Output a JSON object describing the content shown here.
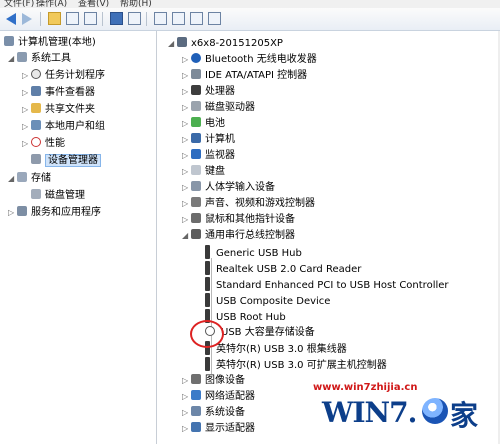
{
  "menu": {
    "file": "文件(F)",
    "action": "操作(A)",
    "view": "查看(V)",
    "help": "帮助(H)"
  },
  "left_tree": [
    {
      "label": "计算机管理(本地)",
      "icon": "computer-management-icon"
    },
    {
      "label": "系统工具",
      "icon": "tools-icon"
    },
    {
      "label": "任务计划程序",
      "icon": "clock-icon"
    },
    {
      "label": "事件查看器",
      "icon": "event-viewer-icon"
    },
    {
      "label": "共享文件夹",
      "icon": "shared-folder-icon"
    },
    {
      "label": "本地用户和组",
      "icon": "users-icon"
    },
    {
      "label": "性能",
      "icon": "performance-icon"
    },
    {
      "label": "设备管理器",
      "icon": "device-manager-icon",
      "selected": true
    },
    {
      "label": "存储",
      "icon": "storage-icon"
    },
    {
      "label": "磁盘管理",
      "icon": "disk-management-icon"
    },
    {
      "label": "服务和应用程序",
      "icon": "services-icon"
    }
  ],
  "device_tree": {
    "root": "x6x8-20151205XP",
    "categories": [
      "Bluetooth 无线电收发器",
      "IDE ATA/ATAPI 控制器",
      "处理器",
      "磁盘驱动器",
      "电池",
      "计算机",
      "监视器",
      "键盘",
      "人体学输入设备",
      "声音、视频和游戏控制器",
      "鼠标和其他指针设备",
      "通用串行总线控制器"
    ],
    "usb_devices": [
      "Generic USB Hub",
      "Realtek USB 2.0 Card Reader",
      "Standard Enhanced PCI to USB Host Controller",
      "USB Composite Device",
      "USB Root Hub",
      "USB 大容量存储设备",
      "英特尔(R) USB 3.0 根集线器",
      "英特尔(R) USB 3.0 可扩展主机控制器"
    ],
    "more_categories": [
      "图像设备",
      "网络适配器",
      "系统设备",
      "显示适配器"
    ]
  },
  "watermark": {
    "url": "www.win7zhijia.cn",
    "logo_text": "WIN7.",
    "logo_char": "家"
  },
  "colors": {
    "selection": "#cfe3fa",
    "highlight_circle": "#dd2222",
    "logo_blue": "#0c3e8a"
  }
}
